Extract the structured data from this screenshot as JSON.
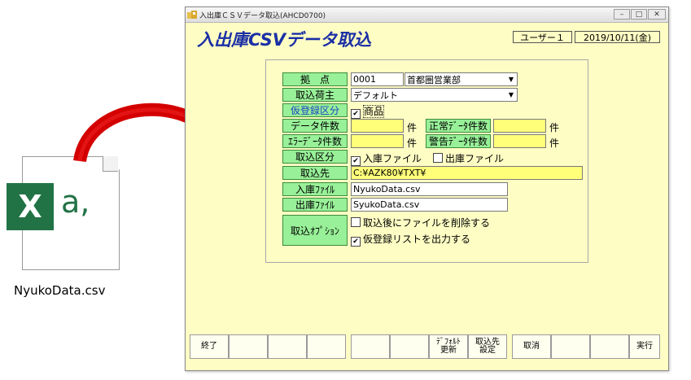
{
  "file": {
    "name": "NyukoData.csv",
    "badge_letter": "X",
    "glyph": "a,"
  },
  "window": {
    "title": "入出庫ＣＳＶデータ取込(AHCD0700)",
    "controls": {
      "minimize": "–",
      "maximize": "□",
      "close": "✕"
    },
    "heading": "入出庫CSVデータ取込",
    "user": "ユーザー１",
    "date": "2019/10/11(金)"
  },
  "form": {
    "base": {
      "label": "拠　点",
      "code": "0001",
      "name": "首都圏営業部"
    },
    "shipper": {
      "label": "取込荷主",
      "value": "デフォルト"
    },
    "provisional": {
      "label": "仮登録区分",
      "option": "商品",
      "checked": true
    },
    "data_count": {
      "label": "データ件数",
      "unit": "件",
      "value": ""
    },
    "normal_count": {
      "label": "正常ﾃﾞｰﾀ件数",
      "unit": "件",
      "value": ""
    },
    "error_count": {
      "label": "ｴﾗｰﾃﾞｰﾀ件数",
      "unit": "件",
      "value": ""
    },
    "warning_count": {
      "label": "警告ﾃﾞｰﾀ件数",
      "unit": "件",
      "value": ""
    },
    "import_type": {
      "label": "取込区分",
      "opt_in": "入庫ファイル",
      "in_checked": true,
      "opt_out": "出庫ファイル",
      "out_checked": false
    },
    "import_dest": {
      "label": "取込先",
      "value": "C:¥AZK80¥TXT¥"
    },
    "in_file": {
      "label": "入庫ﾌｧｲﾙ",
      "value": "NyukoData.csv"
    },
    "out_file": {
      "label": "出庫ﾌｧｲﾙ",
      "value": "SyukoData.csv"
    },
    "options": {
      "label": "取込ｵﾌﾟｼｮﾝ",
      "delete_after": {
        "text": "取込後にファイルを削除する",
        "checked": false
      },
      "output_list": {
        "text": "仮登録リストを出力する",
        "checked": true
      }
    }
  },
  "buttons": {
    "end": "終了",
    "default_update_1": "ﾃﾞﾌｫﾙﾄ",
    "default_update_2": "更新",
    "dest_setting_1": "取込先",
    "dest_setting_2": "設定",
    "cancel": "取消",
    "execute": "実行"
  },
  "colors": {
    "window_bg": "#fefdc4",
    "label_bg": "#98f098",
    "heading": "#1b2fa6",
    "arrow": "#d40000",
    "excel": "#217346"
  }
}
